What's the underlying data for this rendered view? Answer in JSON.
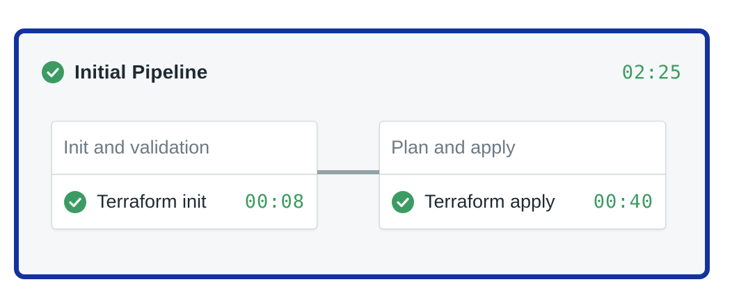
{
  "pipeline": {
    "title": "Initial Pipeline",
    "status": "passed",
    "duration": "02:25",
    "accent_color": "#13329e",
    "success_color": "#3c9b62",
    "blocks": [
      {
        "name": "Init and validation",
        "jobs": [
          {
            "name": "Terraform init",
            "duration": "00:08",
            "status": "passed",
            "icon": "check-circle-icon"
          }
        ]
      },
      {
        "name": "Plan and apply",
        "jobs": [
          {
            "name": "Terraform apply",
            "duration": "00:40",
            "status": "passed",
            "icon": "check-circle-icon"
          }
        ]
      }
    ]
  }
}
